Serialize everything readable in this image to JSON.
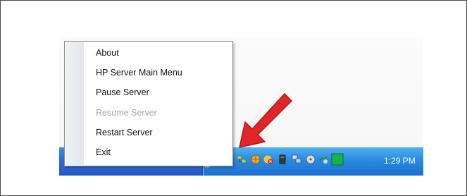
{
  "menu": {
    "items": [
      {
        "label": "About",
        "enabled": true
      },
      {
        "label": "HP Server Main Menu",
        "enabled": true
      },
      {
        "label": "Pause Server",
        "enabled": true
      },
      {
        "label": "Resume Server",
        "enabled": false
      },
      {
        "label": "Restart Server",
        "enabled": true
      },
      {
        "label": "Exit",
        "enabled": true
      }
    ]
  },
  "tray": {
    "clock": "1:29 PM",
    "icons": [
      "antivirus-icon",
      "network-icon",
      "globe-icon",
      "security-alert-icon",
      "device-icon",
      "monitor-icon",
      "cd-icon",
      "update-icon",
      "green-status-icon"
    ]
  },
  "colors": {
    "taskbar": "#2458c4",
    "tray": "#2a8ae0",
    "arrow": "#e0262a",
    "disabled_text": "#a8a8a8"
  }
}
